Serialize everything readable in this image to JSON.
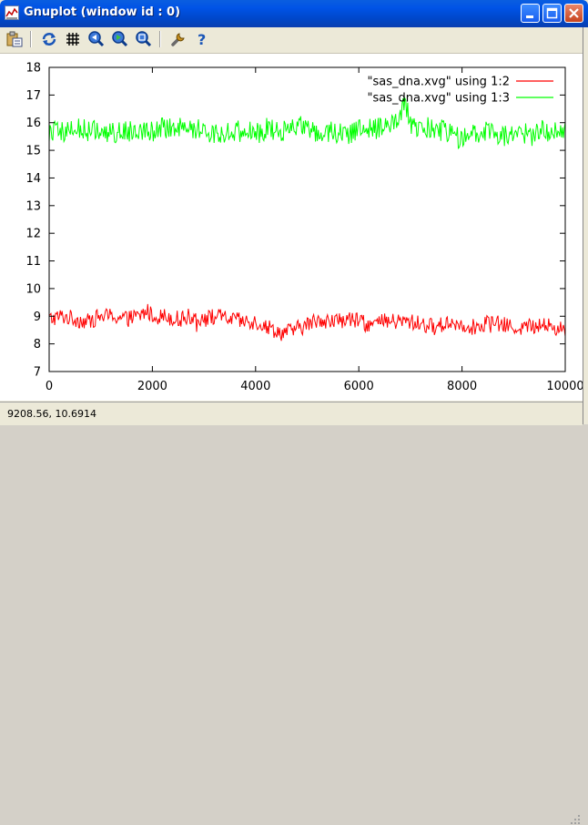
{
  "window": {
    "title": "Gnuplot (window id : 0)"
  },
  "toolbar": {
    "items": [
      {
        "name": "copy-to-clipboard-icon"
      },
      {
        "name": "replot-icon"
      },
      {
        "name": "grid-icon"
      },
      {
        "name": "zoom-previous-icon"
      },
      {
        "name": "zoom-next-icon"
      },
      {
        "name": "autoscale-icon"
      },
      {
        "name": "options-icon"
      },
      {
        "name": "help-icon"
      }
    ]
  },
  "status_bar": {
    "text": "9208.56,  10.6914"
  },
  "colors": {
    "series1": "#ff0000",
    "series2": "#00ff00"
  },
  "chart_data": {
    "type": "line",
    "title": "",
    "xlabel": "",
    "ylabel": "",
    "xlim": [
      0,
      10000
    ],
    "ylim": [
      7,
      18
    ],
    "xticks": [
      0,
      2000,
      4000,
      6000,
      8000,
      10000
    ],
    "xtick_labels": [
      "0",
      "2000",
      "4000",
      "6000",
      "8000",
      "10000"
    ],
    "yticks": [
      7,
      8,
      9,
      10,
      11,
      12,
      13,
      14,
      15,
      16,
      17,
      18
    ],
    "ytick_labels": [
      "7",
      "8",
      "9",
      "10",
      "11",
      "12",
      "13",
      "14",
      "15",
      "16",
      "17",
      "18"
    ],
    "grid": false,
    "legend_position": "top-right",
    "series": [
      {
        "name": "\"sas_dna.xvg\" using 1:2",
        "color": "#ff0000",
        "x": [
          0,
          250,
          500,
          750,
          1000,
          1250,
          1500,
          1750,
          1900,
          2000,
          2250,
          2500,
          2750,
          3000,
          3250,
          3500,
          3750,
          4000,
          4250,
          4500,
          4750,
          5000,
          5250,
          5500,
          5750,
          6000,
          6250,
          6500,
          6750,
          7000,
          7250,
          7500,
          7750,
          8000,
          8250,
          8500,
          8750,
          9000,
          9250,
          9500,
          9750,
          10000
        ],
        "y": [
          8.9,
          9.0,
          8.9,
          8.8,
          9.0,
          9.0,
          8.9,
          9.0,
          9.2,
          9.0,
          9.0,
          8.9,
          9.0,
          8.9,
          9.0,
          8.9,
          8.8,
          8.8,
          8.6,
          8.4,
          8.5,
          8.7,
          8.9,
          8.8,
          8.9,
          8.8,
          8.7,
          8.8,
          8.8,
          8.8,
          8.7,
          8.6,
          8.8,
          8.7,
          8.6,
          8.8,
          8.7,
          8.6,
          8.6,
          8.7,
          8.6,
          8.5
        ],
        "amplitude": 0.3
      },
      {
        "name": "\"sas_dna.xvg\" using 1:3",
        "color": "#00ff00",
        "x": [
          0,
          250,
          500,
          750,
          1000,
          1250,
          1500,
          1750,
          2000,
          2250,
          2500,
          2750,
          3000,
          3250,
          3500,
          3750,
          4000,
          4250,
          4500,
          4750,
          5000,
          5250,
          5500,
          5750,
          6000,
          6250,
          6500,
          6750,
          6900,
          7000,
          7250,
          7500,
          7750,
          8000,
          8250,
          8500,
          8750,
          9000,
          9250,
          9500,
          9750,
          10000
        ],
        "y": [
          15.7,
          15.6,
          15.8,
          15.7,
          15.7,
          15.6,
          15.7,
          15.8,
          15.7,
          15.8,
          15.9,
          15.8,
          15.7,
          15.6,
          15.7,
          15.7,
          15.6,
          15.8,
          15.7,
          15.9,
          15.8,
          15.6,
          15.7,
          15.6,
          15.7,
          15.8,
          15.8,
          16.0,
          16.7,
          15.9,
          15.8,
          15.8,
          15.6,
          15.4,
          15.6,
          15.7,
          15.5,
          15.6,
          15.5,
          15.6,
          15.7,
          15.8
        ],
        "amplitude": 0.4
      }
    ]
  }
}
